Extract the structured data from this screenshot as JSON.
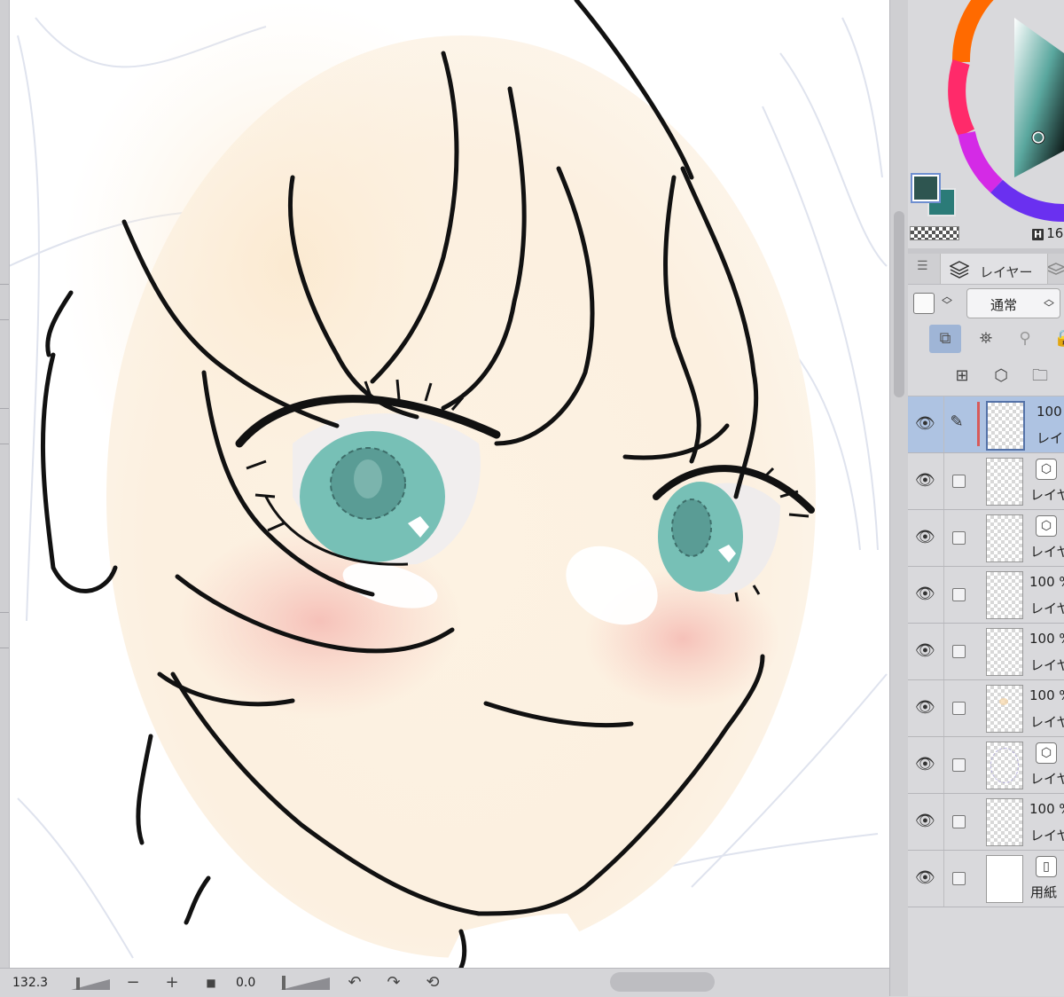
{
  "bottom_bar": {
    "zoom_value": "132.3",
    "zoom_out": "−",
    "zoom_in": "+",
    "stop_icon": "■",
    "rotation_value": "0.0",
    "undo_icon": "↶",
    "redo_icon": "↷",
    "reset_icon": "⟲"
  },
  "color": {
    "main_color": "#2e5550",
    "sub_color": "#2b7b78",
    "h_badge": "H",
    "h_value": "16"
  },
  "layer_panel": {
    "menu_icon": "☰",
    "tab_label": "レイヤー",
    "blend_mode": "通常",
    "layers": [
      {
        "opacity": "100",
        "name": "レイ",
        "selected": true
      },
      {
        "opacity": "",
        "name": "レイヤ",
        "icon": "⬡"
      },
      {
        "opacity": "",
        "name": "レイヤ",
        "icon": "⬡"
      },
      {
        "opacity": "100 %",
        "name": "レイヤ"
      },
      {
        "opacity": "100 %",
        "name": "レイヤ"
      },
      {
        "opacity": "100 %",
        "name": "レイヤ"
      },
      {
        "opacity": "",
        "name": "レイヤ",
        "icon": "⬡"
      },
      {
        "opacity": "100 %",
        "name": "レイヤ"
      },
      {
        "opacity": "",
        "name": "用紙",
        "icon": "▯",
        "paper": true
      }
    ]
  }
}
